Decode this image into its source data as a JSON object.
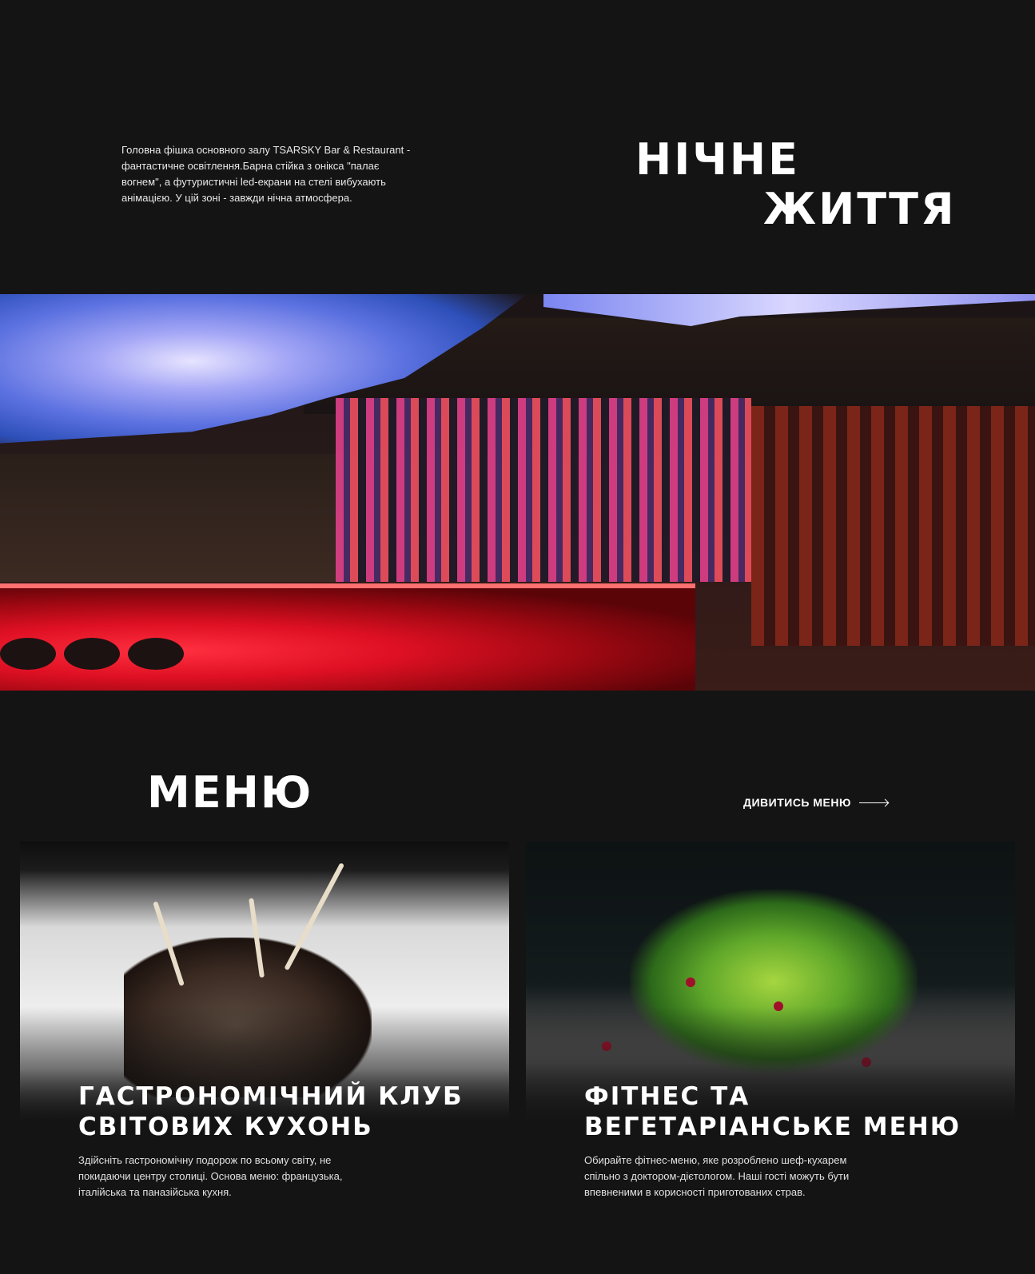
{
  "intro": {
    "text": "Головна фішка основного залу TSARSKY Bar & Restaurant - фантастичне освітлення.Барна стійка з оніксa \"палає вогнем\", а футуристичні led-екрани на стелі вибухають анімацією. У цій зоні - завжди нічна атмосфера.",
    "title_line1": "НІЧНЕ",
    "title_line2": "ЖИТТЯ"
  },
  "menu": {
    "title": "МЕНЮ",
    "link_label": "ДИВИТИСЬ МЕНЮ"
  },
  "cards": [
    {
      "title": "ГАСТРОНОМІЧНИЙ КЛУБ\nСВІТОВИХ КУХОНЬ",
      "description": "Здійсніть гастрономічну подорож по всьому світу, не\nпокидаючи центру столиці. Основа меню: французька,\nіталійська та паназійська кухня."
    },
    {
      "title": "ФІТНЕС ТА\nВЕГЕТАРІАНСЬКЕ МЕНЮ",
      "description": "Обирайте фітнес-меню, яке розроблено шеф-кухарем\nспільно з доктором-дієтологом. Наші гості можуть бути\nвпевненими в корисності приготованих страв."
    }
  ],
  "colors": {
    "background": "#141414",
    "text": "#ffffff",
    "bar_red": "#e01024",
    "led_blue": "#5b71e0"
  },
  "icons": {
    "menu_link_arrow": "arrow-right-icon"
  }
}
